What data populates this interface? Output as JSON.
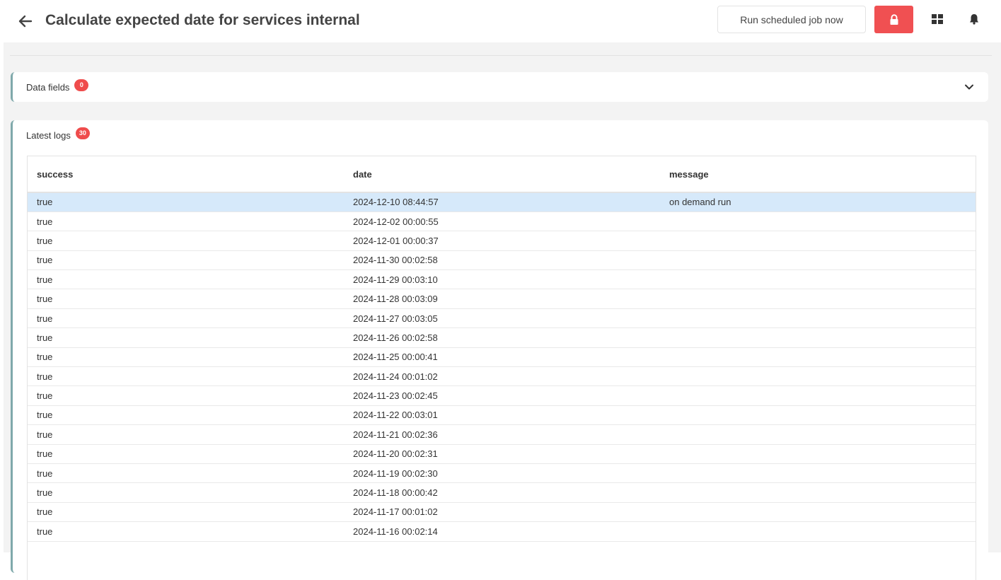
{
  "header": {
    "title": "Calculate expected date for services internal",
    "run_button_label": "Run scheduled job now"
  },
  "colors": {
    "accent_red": "#f05052",
    "card_border": "#7fa9ab",
    "selected_row": "#d6e9fa"
  },
  "data_fields": {
    "label": "Data fields",
    "count": "0"
  },
  "latest_logs": {
    "label": "Latest logs",
    "count": "30",
    "columns": [
      "success",
      "date",
      "message"
    ],
    "rows": [
      {
        "success": "true",
        "date": "2024-12-10 08:44:57",
        "message": "on demand run"
      },
      {
        "success": "true",
        "date": "2024-12-02 00:00:55",
        "message": ""
      },
      {
        "success": "true",
        "date": "2024-12-01 00:00:37",
        "message": ""
      },
      {
        "success": "true",
        "date": "2024-11-30 00:02:58",
        "message": ""
      },
      {
        "success": "true",
        "date": "2024-11-29 00:03:10",
        "message": ""
      },
      {
        "success": "true",
        "date": "2024-11-28 00:03:09",
        "message": ""
      },
      {
        "success": "true",
        "date": "2024-11-27 00:03:05",
        "message": ""
      },
      {
        "success": "true",
        "date": "2024-11-26 00:02:58",
        "message": ""
      },
      {
        "success": "true",
        "date": "2024-11-25 00:00:41",
        "message": ""
      },
      {
        "success": "true",
        "date": "2024-11-24 00:01:02",
        "message": ""
      },
      {
        "success": "true",
        "date": "2024-11-23 00:02:45",
        "message": ""
      },
      {
        "success": "true",
        "date": "2024-11-22 00:03:01",
        "message": ""
      },
      {
        "success": "true",
        "date": "2024-11-21 00:02:36",
        "message": ""
      },
      {
        "success": "true",
        "date": "2024-11-20 00:02:31",
        "message": ""
      },
      {
        "success": "true",
        "date": "2024-11-19 00:02:30",
        "message": ""
      },
      {
        "success": "true",
        "date": "2024-11-18 00:00:42",
        "message": ""
      },
      {
        "success": "true",
        "date": "2024-11-17 00:01:02",
        "message": ""
      },
      {
        "success": "true",
        "date": "2024-11-16 00:02:14",
        "message": ""
      }
    ]
  }
}
